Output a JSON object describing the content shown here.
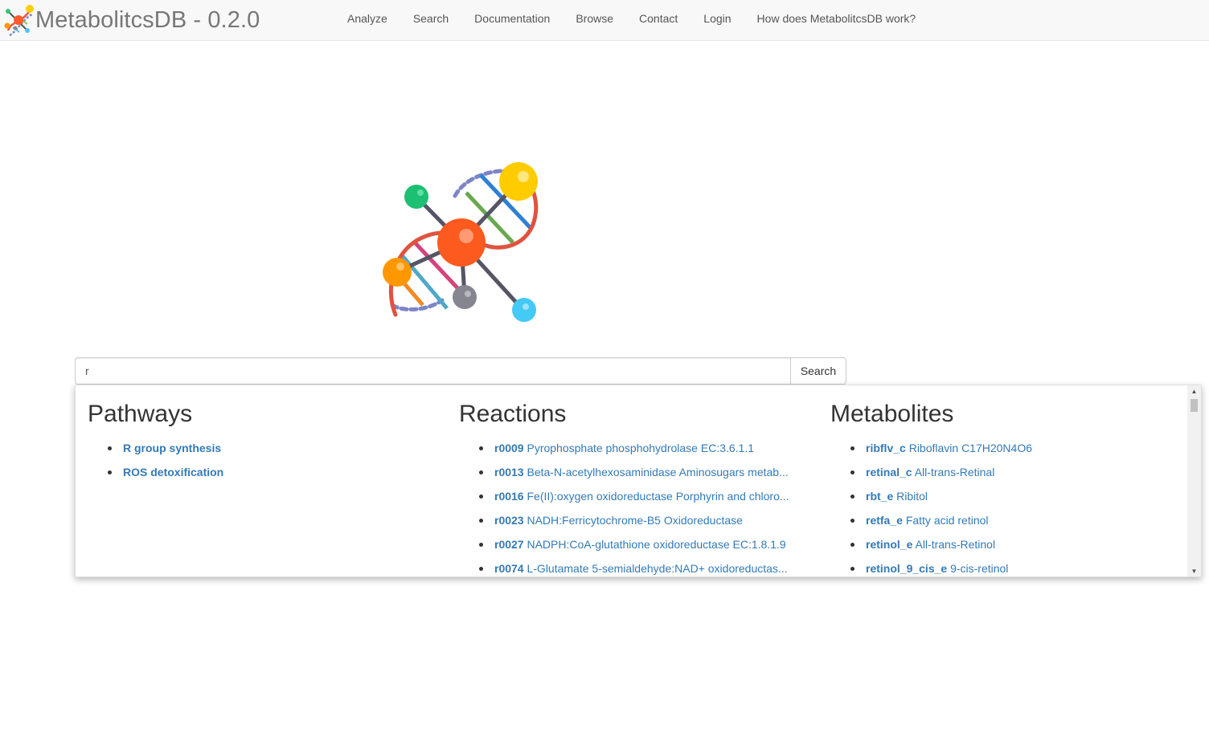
{
  "brand": {
    "title": "MetabolitcsDB - 0.2.0"
  },
  "nav": [
    {
      "label": "Analyze"
    },
    {
      "label": "Search"
    },
    {
      "label": "Documentation"
    },
    {
      "label": "Browse"
    },
    {
      "label": "Contact"
    },
    {
      "label": "Login"
    },
    {
      "label": "How does MetabolitcsDB work?"
    }
  ],
  "search": {
    "value": "r",
    "button_label": "Search"
  },
  "results": {
    "pathways": {
      "heading": "Pathways",
      "items": [
        {
          "id": "R group synthesis",
          "desc": ""
        },
        {
          "id": "ROS detoxification",
          "desc": ""
        }
      ]
    },
    "reactions": {
      "heading": "Reactions",
      "items": [
        {
          "id": "r0009",
          "desc": "Pyrophosphate phosphohydrolase EC:3.6.1.1"
        },
        {
          "id": "r0013",
          "desc": "Beta-N-acetylhexosaminidase Aminosugars metab..."
        },
        {
          "id": "r0016",
          "desc": "Fe(II):oxygen oxidoreductase Porphyrin and chloro..."
        },
        {
          "id": "r0023",
          "desc": "NADH:Ferricytochrome-B5 Oxidoreductase"
        },
        {
          "id": "r0027",
          "desc": "NADPH:CoA-glutathione oxidoreductase EC:1.8.1.9"
        },
        {
          "id": "r0074",
          "desc": "L-Glutamate 5-semialdehyde:NAD+ oxidoreductas..."
        }
      ]
    },
    "metabolites": {
      "heading": "Metabolites",
      "items": [
        {
          "id": "ribflv_c",
          "desc": "Riboflavin C17H20N4O6"
        },
        {
          "id": "retinal_c",
          "desc": "All-trans-Retinal"
        },
        {
          "id": "rbt_e",
          "desc": "Ribitol"
        },
        {
          "id": "retfa_e",
          "desc": "Fatty acid retinol"
        },
        {
          "id": "retinol_e",
          "desc": "All-trans-Retinol"
        },
        {
          "id": "retinol_9_cis_e",
          "desc": "9-cis-retinol"
        }
      ]
    }
  },
  "colors": {
    "link": "#337ab7",
    "navbar_bg": "#f8f8f8",
    "brand_text": "#777777"
  }
}
